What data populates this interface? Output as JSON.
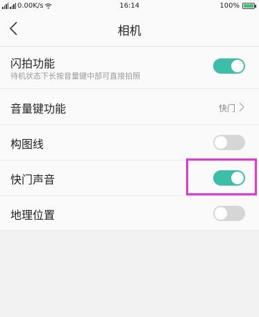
{
  "statusbar": {
    "signal1": "▐▐",
    "net_speed": "0.00K/s",
    "time": "16:14",
    "battery_pct": "100%"
  },
  "header": {
    "title": "相机",
    "back_icon": "chevron-left-icon"
  },
  "settings": {
    "flash": {
      "label": "闪拍功能",
      "sub": "待机状态下长按音量键中部可直接拍照",
      "on": true
    },
    "volume": {
      "label": "音量键功能",
      "value": "快门"
    },
    "grid": {
      "label": "构图线",
      "on": false
    },
    "shutter_sound": {
      "label": "快门声音",
      "on": true
    },
    "location": {
      "label": "地理位置",
      "on": false
    }
  },
  "colors": {
    "toggle_on": "#3cbfa6",
    "toggle_off": "#d6d6d6",
    "highlight": "#e834d8",
    "battery": "#3cc26a"
  }
}
